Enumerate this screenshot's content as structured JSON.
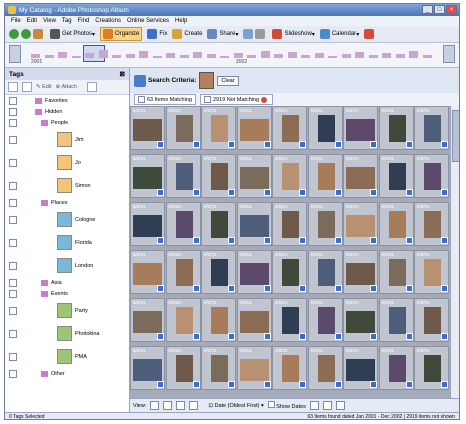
{
  "window": {
    "title": "My Catalog - Adobe Photoshop Album"
  },
  "menu": [
    "File",
    "Edit",
    "View",
    "Tag",
    "Find",
    "Creations",
    "Online Services",
    "Help"
  ],
  "toolbar": {
    "get_photos": "Get Photos",
    "organize": "Organize",
    "fix": "Fix",
    "create": "Create",
    "share": "Share",
    "slideshow": "Slideshow",
    "calendar": "Calendar"
  },
  "timeline": {
    "year_start": "2001",
    "year_end": "2002"
  },
  "sidebar": {
    "title": "Tags",
    "edit": "Edit",
    "attach": "Attach",
    "tags": [
      {
        "label": "Favorites",
        "kind": "category"
      },
      {
        "label": "Hidden",
        "kind": "category"
      },
      {
        "label": "People",
        "kind": "category"
      },
      {
        "label": "Jim",
        "kind": "person"
      },
      {
        "label": "Jo",
        "kind": "person"
      },
      {
        "label": "Simon",
        "kind": "person"
      },
      {
        "label": "Places",
        "kind": "category"
      },
      {
        "label": "Cologne",
        "kind": "place"
      },
      {
        "label": "Florida",
        "kind": "place"
      },
      {
        "label": "London",
        "kind": "place"
      },
      {
        "label": "Asia",
        "kind": "category"
      },
      {
        "label": "Events",
        "kind": "category"
      },
      {
        "label": "Party",
        "kind": "event"
      },
      {
        "label": "Photokina",
        "kind": "event"
      },
      {
        "label": "PMA",
        "kind": "event"
      },
      {
        "label": "Other",
        "kind": "category"
      }
    ]
  },
  "search": {
    "label": "Search Criteria:",
    "clear": "Clear"
  },
  "matching": {
    "matching": "63 Items Matching",
    "not_matching": "2919 Not Matching"
  },
  "grid": {
    "rows": [
      [
        "6/5/01",
        "6/5/01",
        "6/5/01",
        "6/5/01",
        "6/5/01",
        "6/5/01",
        "6/5/01",
        "6/5/01",
        "6/5/01"
      ],
      [
        "6/5/01",
        "6/5/01",
        "6/5/01",
        "6/5/01",
        "6/5/01",
        "6/5/01",
        "6/5/01",
        "6/5/01",
        "6/5/01"
      ],
      [
        "6/5/01",
        "6/5/01",
        "6/5/01",
        "6/5/01",
        "6/5/01",
        "6/5/01",
        "6/5/01",
        "6/5/01",
        "6/5/01"
      ],
      [
        "6/5/01",
        "6/5/01",
        "6/5/01",
        "6/5/01",
        "6/5/01",
        "6/5/01",
        "6/5/01",
        "6/5/01",
        "6/5/01"
      ],
      [
        "6/5/01",
        "6/5/01",
        "6/5/01",
        "6/5/01",
        "6/5/01",
        "6/5/01",
        "6/5/01",
        "6/5/01",
        "6/5/01"
      ],
      [
        "6/5/01",
        "6/5/01",
        "6/5/01",
        "6/5/01",
        "2/6/02",
        "6/5/01",
        "6/5/01",
        "6/5/01",
        "6/5/01"
      ]
    ]
  },
  "bottom": {
    "view": "View:",
    "sort": "Date (Oldest First)",
    "show_dates": "Show Dates"
  },
  "status": {
    "left": "0 Tags Selected",
    "right": "63 Items found dated Jan 2001 - Dec 2002  |  2919 items not shown"
  },
  "colors": {
    "accent": "#3d6fc9",
    "grid_bg": "#a5abb8"
  }
}
